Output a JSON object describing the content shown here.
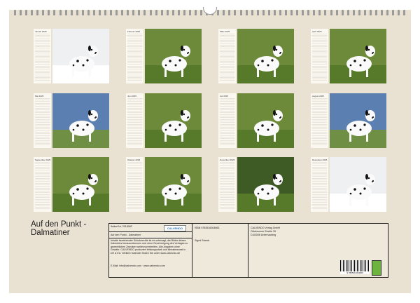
{
  "calendar": {
    "title": "Auf den Punkt - Dalmatiner",
    "months": [
      {
        "label": "Januar 2025",
        "scene": "snow"
      },
      {
        "label": "Februar 2025",
        "scene": "meadow"
      },
      {
        "label": "März 2025",
        "scene": "meadow"
      },
      {
        "label": "April 2025",
        "scene": "meadow"
      },
      {
        "label": "Mai 2025",
        "scene": "sky"
      },
      {
        "label": "Juni 2025",
        "scene": "meadow"
      },
      {
        "label": "Juli 2025",
        "scene": "meadow"
      },
      {
        "label": "August 2025",
        "scene": "sky"
      },
      {
        "label": "September 2025",
        "scene": "meadow"
      },
      {
        "label": "Oktober 2025",
        "scene": "meadow"
      },
      {
        "label": "November 2025",
        "scene": "forest"
      },
      {
        "label": "Dezember 2025",
        "scene": "snow"
      }
    ]
  },
  "info": {
    "article_label": "Artikel-Nr. 2015082",
    "badge": "CALVENDO",
    "isbn": "ISBN 9783516004663",
    "publisher": [
      "CALVENDO Verlag GmbH",
      "Ottobrunner Straße 39",
      "D-82008 Unterhaching"
    ],
    "title_repeat": "Auf den Punkt - Dalmatiner",
    "author": "Sigrid Starick",
    "legal": "Inhalte bestehender Schutzrechte ist es untersagt, die Bilder dieses Kalenders herauszutrennen und ohne Genehmigung des Verlages zu gewerblichen Zwecken weiterzuverbreiten. Alle Angaben ohne Gewähr. CALVENDO produziert leistungsstark und klimabewusst in DE & EU. Weitere Kalender finden Sie unter www.calvendo.de",
    "email": "E-Mail: info@calvendo.com · www.calvendo.com",
    "barcode_digits": "9 783516 004663"
  },
  "colors": {
    "sheet": "#e9e2d2",
    "snow": "#eef0f2",
    "meadow": "#6d8a3a",
    "sky": "#5b7fb0",
    "forest": "#3e5a25"
  }
}
